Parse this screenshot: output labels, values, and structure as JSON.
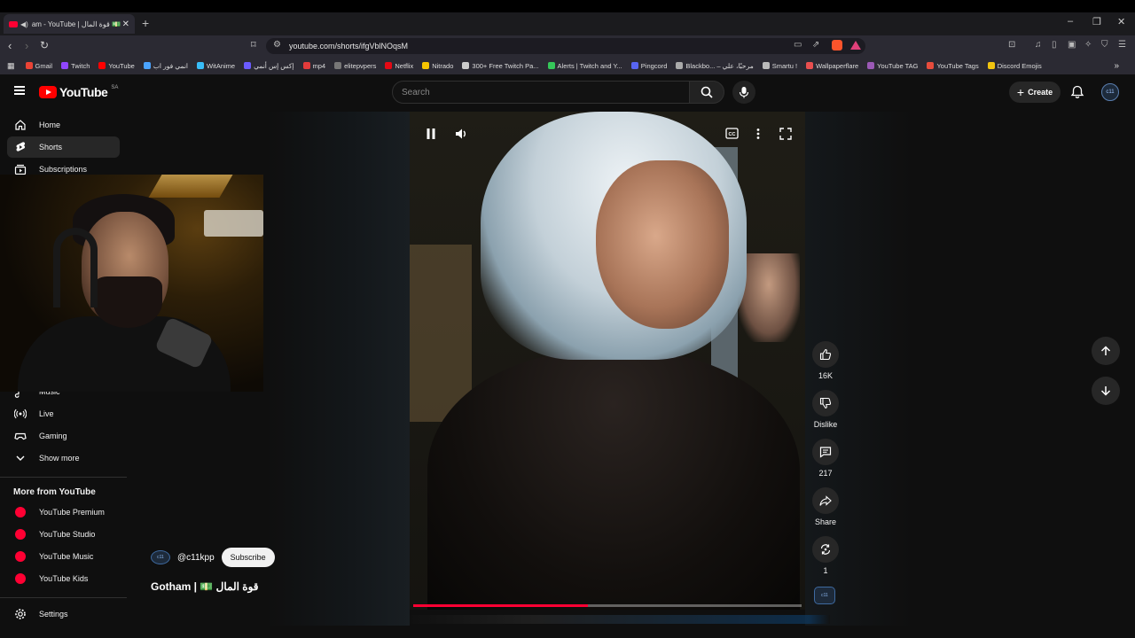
{
  "browser": {
    "tab_title": "am - YouTube | قوة المال 💵",
    "url": "youtube.com/shorts/ifgVblNOqsM",
    "bookmarks": [
      {
        "label": "Gmail",
        "color": "#ea4335"
      },
      {
        "label": "Twitch",
        "color": "#9146ff"
      },
      {
        "label": "YouTube",
        "color": "#ff0000"
      },
      {
        "label": "انمي فور اب",
        "color": "#4aa3ff"
      },
      {
        "label": "WitAnime",
        "color": "#38bdf8"
      },
      {
        "label": "إكس إس أنمي",
        "color": "#6b5bff"
      },
      {
        "label": "mp4",
        "color": "#e23b3b"
      },
      {
        "label": "elitepvpers",
        "color": "#777777"
      },
      {
        "label": "Netflix",
        "color": "#e50914"
      },
      {
        "label": "Nitrado",
        "color": "#f5c400"
      },
      {
        "label": "300+ Free Twitch Pa...",
        "color": "#cccccc"
      },
      {
        "label": "Alerts | Twitch and Y...",
        "color": "#35c759"
      },
      {
        "label": "Pingcord",
        "color": "#5865f2"
      },
      {
        "label": "Blackbo... – مرحبًا، علي",
        "color": "#aaaaaa"
      },
      {
        "label": "Smartu !",
        "color": "#bbbbbb"
      },
      {
        "label": "Wallpaperflare",
        "color": "#e84f4f"
      },
      {
        "label": "YouTube TAG",
        "color": "#9b59b6"
      },
      {
        "label": "YouTube Tags",
        "color": "#e74c3c"
      },
      {
        "label": "Discord Emojis",
        "color": "#f1c40f"
      }
    ]
  },
  "header": {
    "logo_text": "YouTube",
    "region": "SA",
    "search_placeholder": "Search",
    "create_label": "Create",
    "avatar_text": "c11"
  },
  "sidebar": {
    "main": [
      {
        "label": "Home"
      },
      {
        "label": "Shorts"
      },
      {
        "label": "Subscriptions"
      }
    ],
    "explore": [
      {
        "label": "Music"
      },
      {
        "label": "Live"
      },
      {
        "label": "Gaming"
      },
      {
        "label": "Show more"
      }
    ],
    "more_heading": "More from YouTube",
    "more": [
      {
        "label": "YouTube Premium"
      },
      {
        "label": "YouTube Studio"
      },
      {
        "label": "YouTube Music"
      },
      {
        "label": "YouTube Kids"
      }
    ],
    "settings": "Settings"
  },
  "short": {
    "channel": "@c11kpp",
    "channel_avatar_text": "c11",
    "subscribe": "Subscribe",
    "title": "Gotham | 💵 قوة المال",
    "progress": 0.45,
    "actions": {
      "likes": "16K",
      "dislike": "Dislike",
      "comments": "217",
      "share": "Share",
      "remix": "1"
    }
  },
  "colors": {
    "accent": "#ff0033",
    "bg": "#0f0f0f",
    "chip": "#272727"
  }
}
